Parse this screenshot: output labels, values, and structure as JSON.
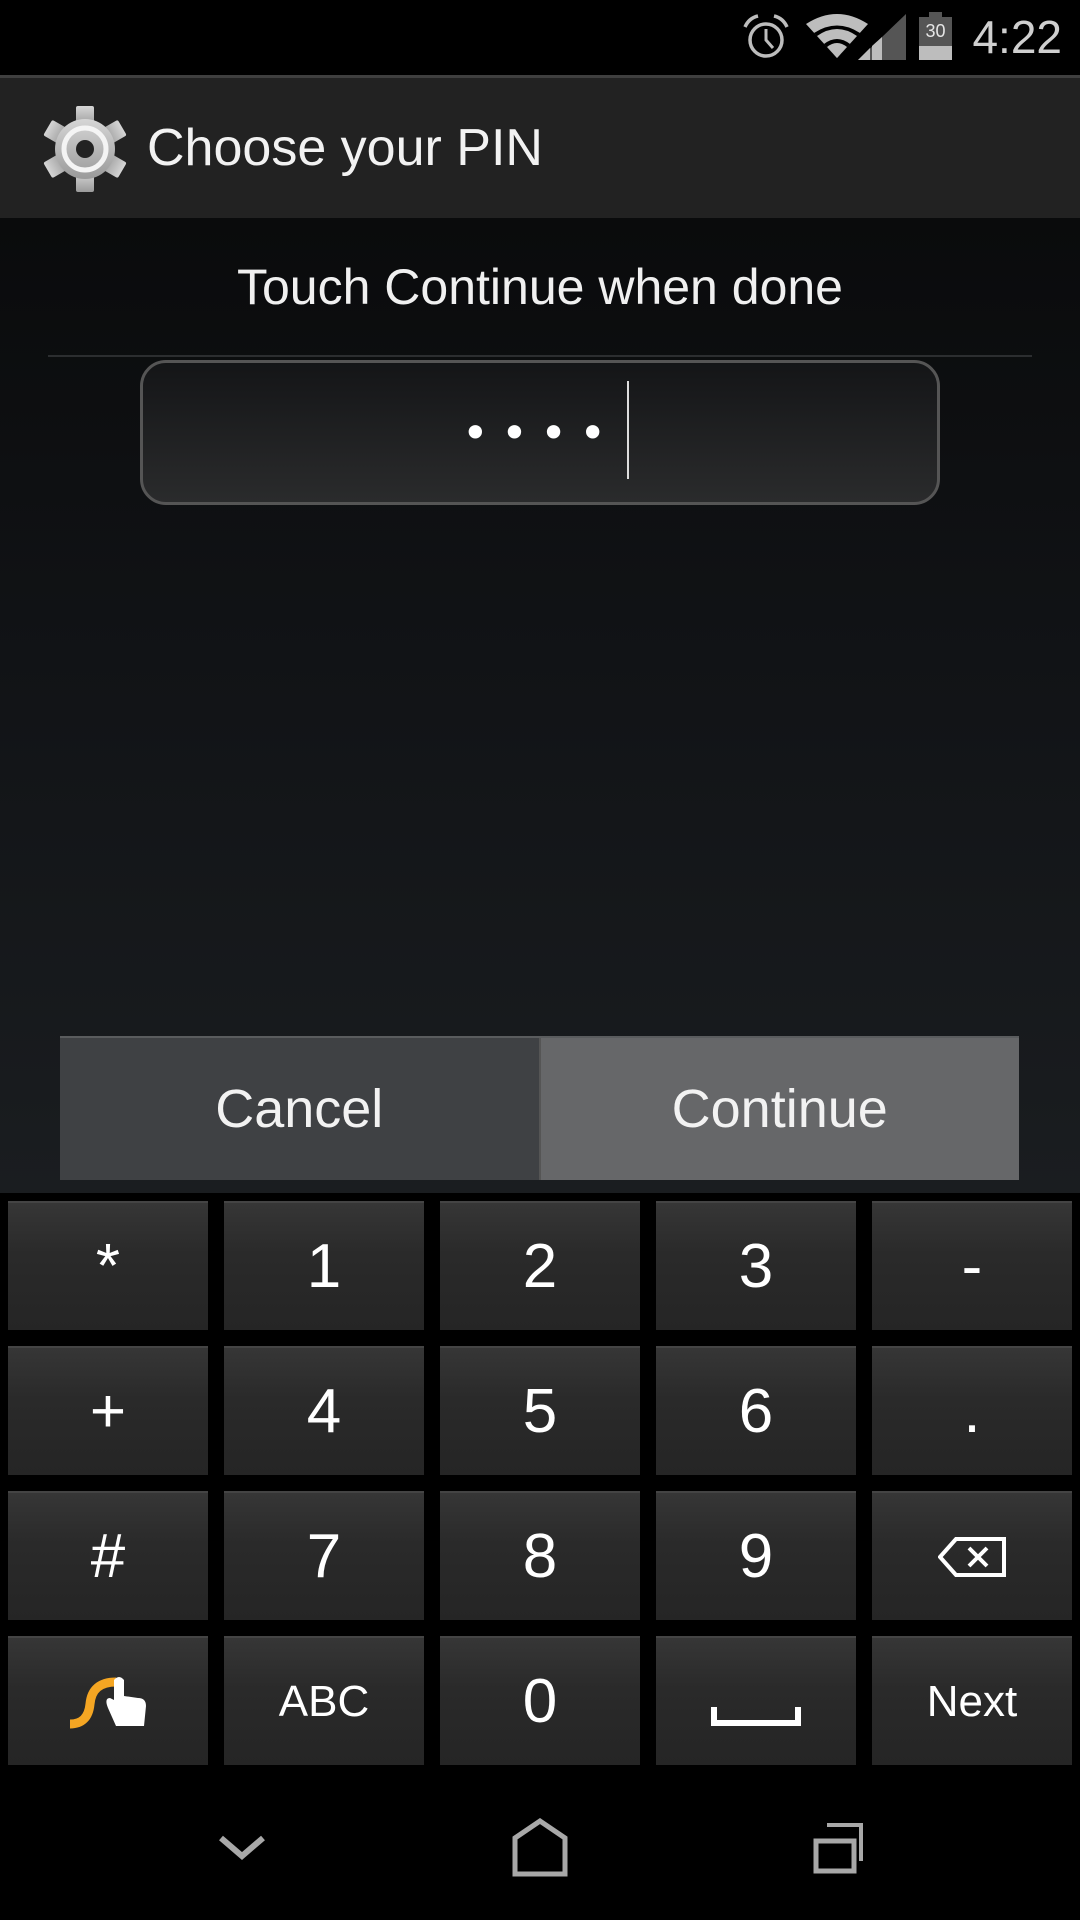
{
  "status_bar": {
    "time": "4:22",
    "battery_level": "30",
    "icons": [
      "alarm-icon",
      "wifi-icon",
      "cell-signal-icon",
      "battery-icon"
    ]
  },
  "action_bar": {
    "title": "Choose your PIN",
    "icon": "settings-gear-icon"
  },
  "content": {
    "prompt": "Touch Continue when done",
    "pin_field": {
      "masked_value": "••••",
      "entered_length": 4
    },
    "buttons": {
      "cancel_label": "Cancel",
      "continue_label": "Continue"
    }
  },
  "keyboard": {
    "rows": [
      [
        "*",
        "1",
        "2",
        "3",
        "-"
      ],
      [
        "+",
        "4",
        "5",
        "6",
        "."
      ],
      [
        "#",
        "7",
        "8",
        "9",
        "backspace-icon"
      ],
      [
        "swype-icon",
        "ABC",
        "0",
        "space-icon",
        "Next"
      ]
    ],
    "keys": {
      "star": "*",
      "k1": "1",
      "k2": "2",
      "k3": "3",
      "minus": "-",
      "plus": "+",
      "k4": "4",
      "k5": "5",
      "k6": "6",
      "period": ".",
      "hash": "#",
      "k7": "7",
      "k8": "8",
      "k9": "9",
      "abc": "ABC",
      "k0": "0",
      "next": "Next"
    },
    "accent_color": "#f5a623"
  },
  "nav_bar": {
    "icons": [
      "back-icon",
      "home-icon",
      "recent-apps-icon"
    ]
  }
}
